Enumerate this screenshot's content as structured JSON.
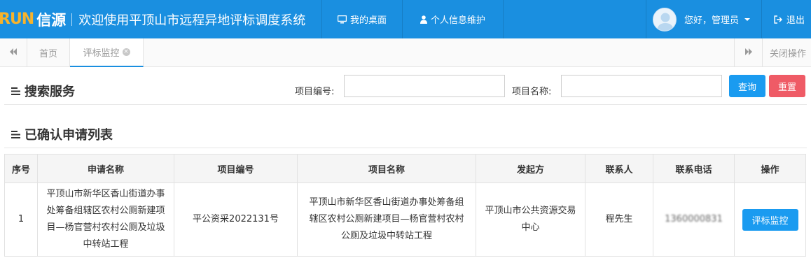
{
  "header": {
    "logo_en": "RUN",
    "logo_cn": "信源",
    "system_title": "欢迎使用平顶山市远程异地评标调度系统",
    "nav_desktop": "我的桌面",
    "nav_profile": "个人信息维护",
    "greeting": "您好，管理员",
    "logout": "退出"
  },
  "tabs": {
    "home": "首页",
    "active": "评标监控",
    "close_ops": "关闭操作"
  },
  "search": {
    "title": "搜索服务",
    "project_no_label": "项目编号:",
    "project_no_value": "",
    "project_name_label": "项目名称:",
    "project_name_value": "",
    "query_button": "查询",
    "reset_button": "重置"
  },
  "list": {
    "title": "已确认申请列表",
    "columns": [
      "序号",
      "申请名称",
      "项目编号",
      "项目名称",
      "发起方",
      "联系人",
      "联系电话",
      "操作"
    ],
    "rows": [
      {
        "index": "1",
        "application_name": "平顶山市新华区香山街道办事处筹备组辖区农村公厕新建项目—杨官营村农村公厕及垃圾中转站工程",
        "project_no": "平公资采2022131号",
        "project_name": "平顶山市新华区香山街道办事处筹备组辖区农村公厕新建项目—杨官营村农村公厕及垃圾中转站工程",
        "initiator": "平顶山市公共资源交易中心",
        "contact": "程先生",
        "phone": "1360000831",
        "action": "评标监控"
      }
    ]
  },
  "colors": {
    "header_bg": "#1a8fe0",
    "logo_accent": "#f7b32b",
    "primary_button": "#1a9bf0",
    "danger_button": "#ef5b66"
  }
}
